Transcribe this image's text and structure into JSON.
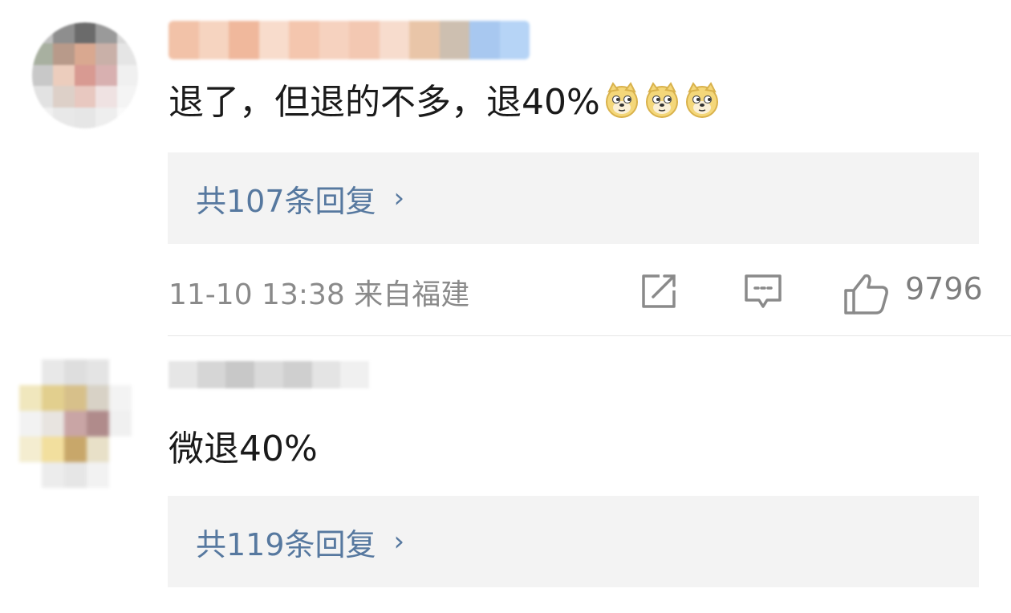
{
  "comments": [
    {
      "text": "退了，但退的不多，退40%",
      "emoji_count": 3,
      "emoji": "doge-emoji",
      "replies_label": "共107条回复",
      "chevron": "›",
      "meta": "11-10 13:38 来自福建",
      "like_count": "9796"
    },
    {
      "text": "微退40%",
      "replies_label": "共119条回复",
      "chevron": "›"
    }
  ],
  "colors": {
    "reply_link": "#56789f",
    "reply_bg": "#f3f3f3",
    "meta": "#8a8a8a",
    "text": "#1a1a1a"
  }
}
